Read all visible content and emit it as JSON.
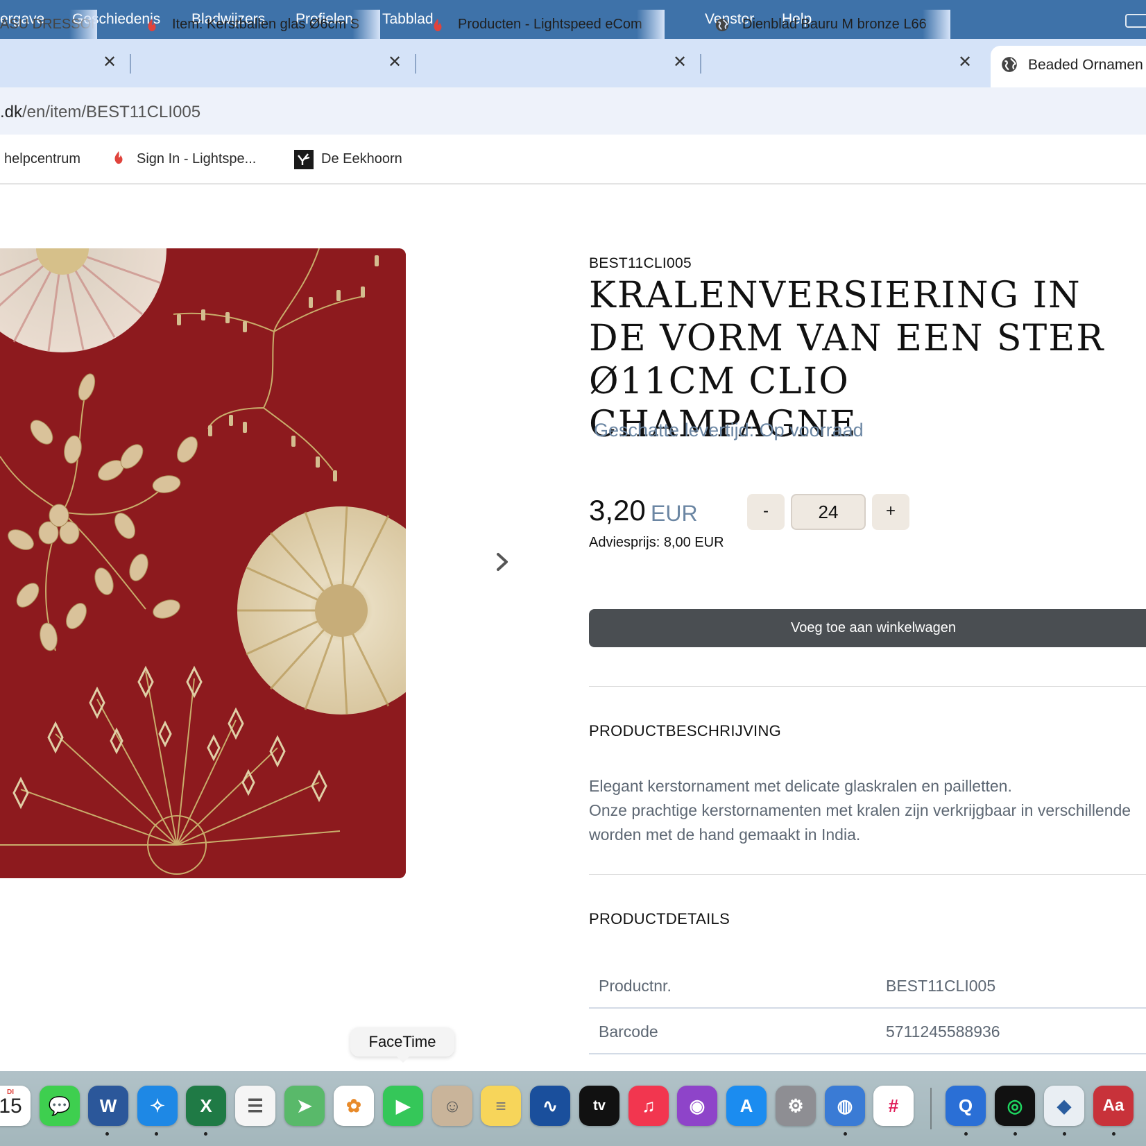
{
  "menubar": {
    "items": [
      "ergave",
      "Geschiedenis",
      "Bladwijzers",
      "Profielen",
      "Tabblad",
      "Venster",
      "Help"
    ]
  },
  "tabs": [
    {
      "title": "ASU DRESSOI",
      "icon": "close-icon"
    },
    {
      "title": "Item: Kerstballen glas Ø6cm S",
      "icon": "lightspeed-flame-icon"
    },
    {
      "title": "Producten - Lightspeed eCom",
      "icon": "lightspeed-flame-icon"
    },
    {
      "title": "Dienblad Bauru M bronze L66",
      "icon": "globe-icon"
    },
    {
      "title": "Beaded Ornamen",
      "icon": "globe-icon",
      "active": true
    }
  ],
  "address": {
    "host_part": ".dk",
    "path_part": "/en/item/BEST11CLI005"
  },
  "bookmarks": [
    {
      "label": "helpcentrum",
      "icon": ""
    },
    {
      "label": "Sign In - Lightspe...",
      "icon": "lightspeed-flame-icon"
    },
    {
      "label": "De Eekhoorn",
      "icon": "eekhoorn-logo-icon"
    }
  ],
  "product": {
    "sku": "BEST11CLI005",
    "title": "KRALENVERSIERING IN DE VORM VAN EEN STER Ø11CM CLIO CHAMPAGNE",
    "delivery": "Geschatte levertijd: Op voorraad",
    "price": "3,20",
    "currency": "EUR",
    "msrp": "Adviesprijs: 8,00 EUR",
    "qty_minus": "-",
    "qty": "24",
    "qty_plus": "+",
    "add_to_cart": "Voeg toe aan winkelwagen",
    "image_alt": "Beaded star ornament on red background"
  },
  "description": {
    "heading": "PRODUCTBESCHRIJVING",
    "lines": [
      "Elegant kerstornament met delicate glaskralen en pailletten.",
      "Onze prachtige kerstornamenten met kralen zijn verkrijgbaar in verschillende",
      "worden met de hand gemaakt in India."
    ]
  },
  "details": {
    "heading": "PRODUCTDETAILS",
    "rows": [
      {
        "label": "Productnr.",
        "value": "BEST11CLI005"
      },
      {
        "label": "Barcode",
        "value": "5711245588936"
      }
    ]
  },
  "dock": {
    "tooltip": "FaceTime",
    "calendar_day": "15",
    "calendar_weekday": "DI",
    "apps": [
      {
        "name": "calendar",
        "color": "#ffffff"
      },
      {
        "name": "messages",
        "color": "#3ecf4f"
      },
      {
        "name": "word",
        "color": "#2b579a"
      },
      {
        "name": "safari",
        "color": "#1e88e5"
      },
      {
        "name": "excel",
        "color": "#1f7a45"
      },
      {
        "name": "reminders",
        "color": "#f5f5f5"
      },
      {
        "name": "maps",
        "color": "#59b96a"
      },
      {
        "name": "photos",
        "color": "#ffffff"
      },
      {
        "name": "facetime",
        "color": "#35c759"
      },
      {
        "name": "contacts",
        "color": "#c9b49a"
      },
      {
        "name": "notes",
        "color": "#f7d55a"
      },
      {
        "name": "freeform",
        "color": "#1a4f9c"
      },
      {
        "name": "tv",
        "color": "#111111"
      },
      {
        "name": "music",
        "color": "#f2364f"
      },
      {
        "name": "podcasts",
        "color": "#8e44c9"
      },
      {
        "name": "app-store",
        "color": "#1b8cf0"
      },
      {
        "name": "system-settings",
        "color": "#8e8e93"
      },
      {
        "name": "preview",
        "color": "#3a7bd5"
      },
      {
        "name": "slack",
        "color": "#ffffff"
      },
      {
        "name": "quicktime",
        "color": "#2a6fd6"
      },
      {
        "name": "spotify",
        "color": "#111111"
      },
      {
        "name": "sketchup",
        "color": "#e9eef3"
      },
      {
        "name": "dictionary",
        "color": "#c8323a"
      }
    ]
  }
}
